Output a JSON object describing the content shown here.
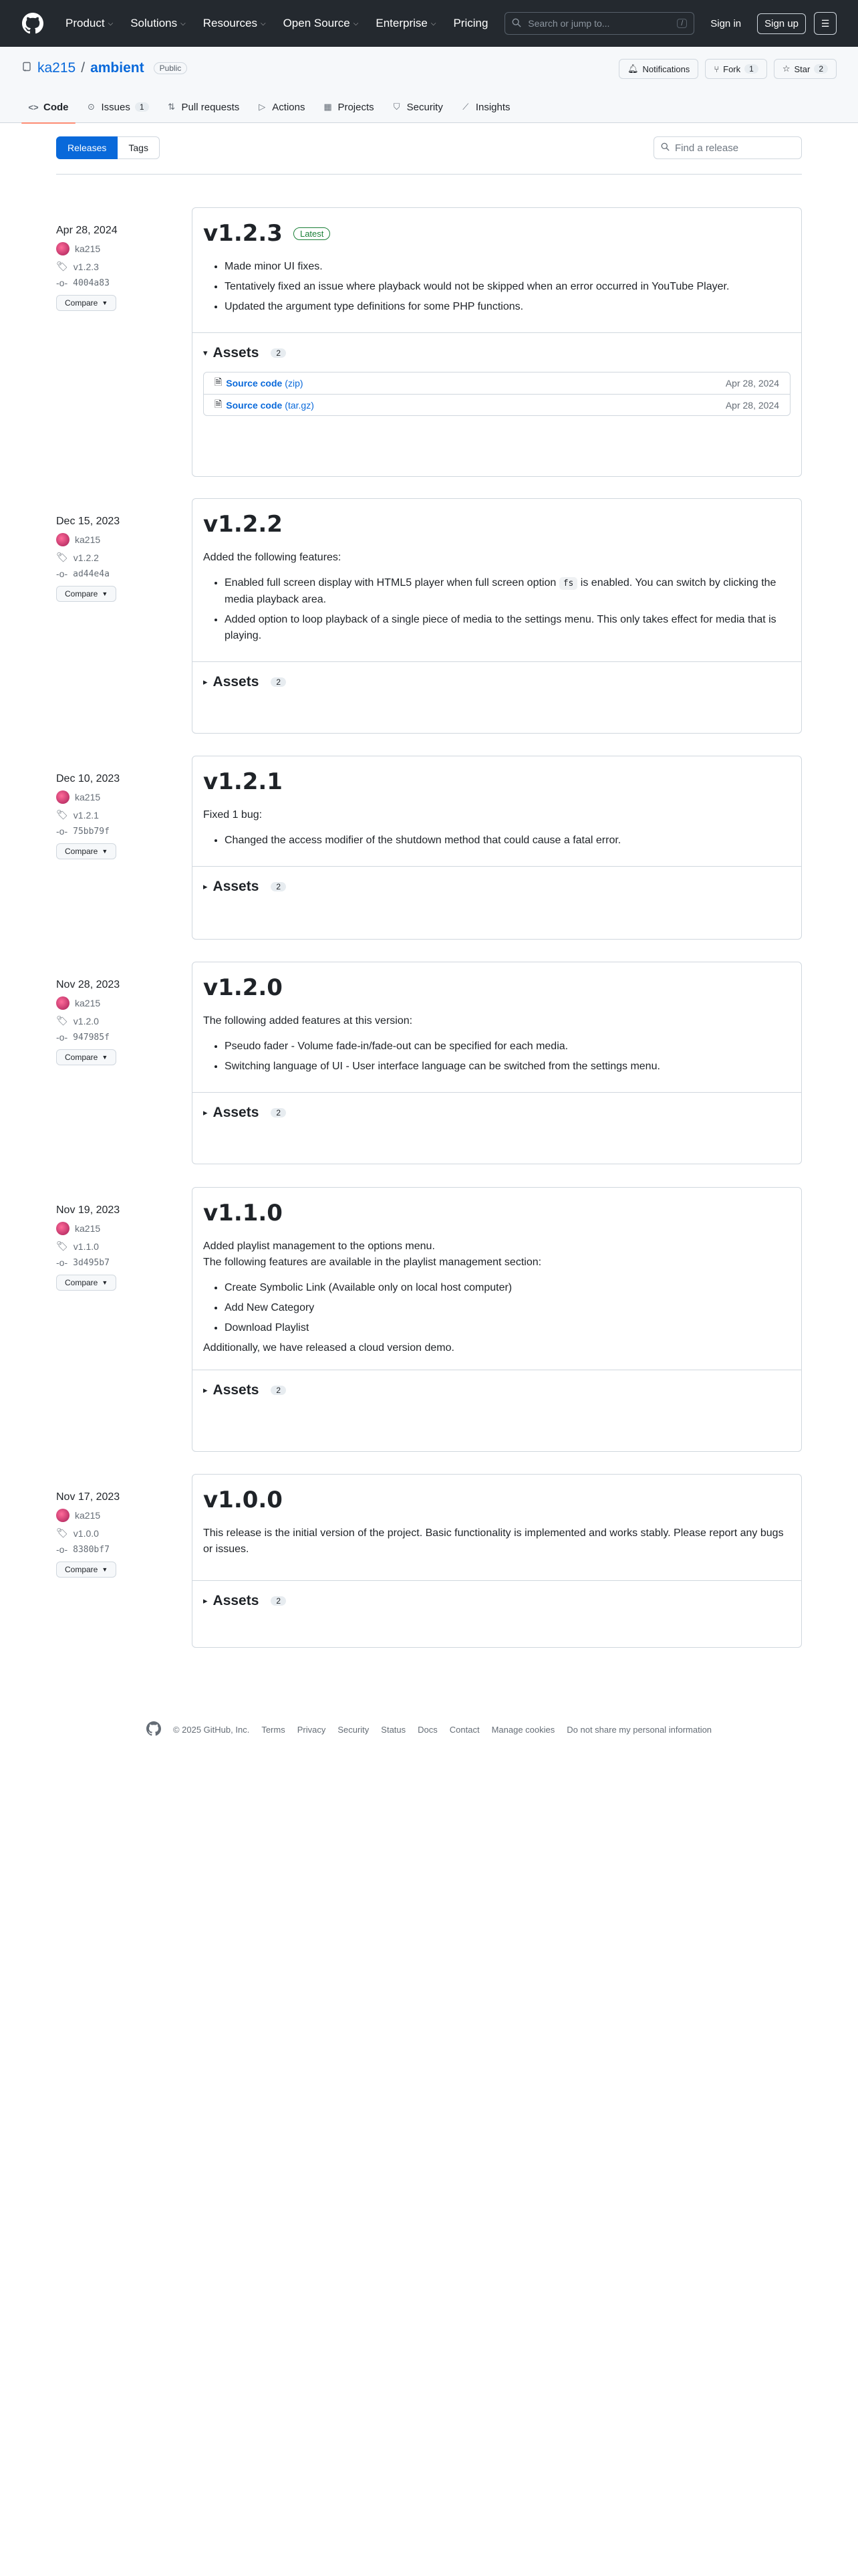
{
  "header": {
    "nav": [
      "Product",
      "Solutions",
      "Resources",
      "Open Source",
      "Enterprise",
      "Pricing"
    ],
    "search_placeholder": "Search or jump to...",
    "search_key": "/",
    "signin": "Sign in",
    "signup": "Sign up"
  },
  "repo": {
    "owner": "ka215",
    "name": "ambient",
    "visibility": "Public",
    "notifications": "Notifications",
    "fork_label": "Fork",
    "fork_count": "1",
    "star_label": "Star",
    "star_count": "2",
    "tabs": [
      {
        "label": "Code",
        "count": ""
      },
      {
        "label": "Issues",
        "count": "1"
      },
      {
        "label": "Pull requests",
        "count": ""
      },
      {
        "label": "Actions",
        "count": ""
      },
      {
        "label": "Projects",
        "count": ""
      },
      {
        "label": "Security",
        "count": ""
      },
      {
        "label": "Insights",
        "count": ""
      }
    ]
  },
  "subnav": {
    "releases": "Releases",
    "tags": "Tags",
    "find_placeholder": "Find a release"
  },
  "releases": [
    {
      "date": "Apr 28, 2024",
      "author": "ka215",
      "tag": "v1.2.3",
      "commit": "4004a83",
      "compare": "Compare",
      "title": "v1.2.3",
      "latest": "Latest",
      "intro": "",
      "notes": [
        "Made minor UI fixes.",
        "Tentatively fixed an issue where playback would not be skipped when an error occurred in YouTube Player.",
        "Updated the argument type definitions for some PHP functions."
      ],
      "after": "",
      "assets_label": "Assets",
      "assets_count": "2",
      "assets": [
        {
          "name": "Source code",
          "ext": "(zip)",
          "date": "Apr 28, 2024"
        },
        {
          "name": "Source code",
          "ext": "(tar.gz)",
          "date": "Apr 28, 2024"
        }
      ]
    },
    {
      "date": "Dec 15, 2023",
      "author": "ka215",
      "tag": "v1.2.2",
      "commit": "ad44e4a",
      "compare": "Compare",
      "title": "v1.2.2",
      "intro": "Added the following features:",
      "notes": [
        "Enabled full screen display with HTML5 player when full screen option |fs| is enabled. You can switch by clicking the media playback area.",
        "Added option to loop playback of a single piece of media to the settings menu. This only takes effect for media that is playing."
      ],
      "after": "",
      "assets_label": "Assets",
      "assets_count": "2"
    },
    {
      "date": "Dec 10, 2023",
      "author": "ka215",
      "tag": "v1.2.1",
      "commit": "75bb79f",
      "compare": "Compare",
      "title": "v1.2.1",
      "intro": "Fixed 1 bug:",
      "notes": [
        "Changed the access modifier of the shutdown method that could cause a fatal error."
      ],
      "after": "",
      "assets_label": "Assets",
      "assets_count": "2"
    },
    {
      "date": "Nov 28, 2023",
      "author": "ka215",
      "tag": "v1.2.0",
      "commit": "947985f",
      "compare": "Compare",
      "title": "v1.2.0",
      "intro": "The following added features at this version:",
      "notes": [
        "Pseudo fader - Volume fade-in/fade-out can be specified for each media.",
        "Switching language of UI - User interface language can be switched from the settings menu."
      ],
      "after": "",
      "assets_label": "Assets",
      "assets_count": "2"
    },
    {
      "date": "Nov 19, 2023",
      "author": "ka215",
      "tag": "v1.1.0",
      "commit": "3d495b7",
      "compare": "Compare",
      "title": "v1.1.0",
      "intro": "Added playlist management to the options menu.\nThe following features are available in the playlist management section:",
      "notes": [
        "Create Symbolic Link (Available only on local host computer)",
        "Add New Category",
        "Download Playlist"
      ],
      "after": "Additionally, we have released a cloud version demo.",
      "assets_label": "Assets",
      "assets_count": "2"
    },
    {
      "date": "Nov 17, 2023",
      "author": "ka215",
      "tag": "v1.0.0",
      "commit": "8380bf7",
      "compare": "Compare",
      "title": "v1.0.0",
      "intro": "This release is the initial version of the project. Basic functionality is implemented and works stably. Please report any bugs or issues.",
      "notes": [],
      "after": "",
      "assets_label": "Assets",
      "assets_count": "2"
    }
  ],
  "footer": {
    "copyright": "© 2025 GitHub, Inc.",
    "links": [
      "Terms",
      "Privacy",
      "Security",
      "Status",
      "Docs",
      "Contact",
      "Manage cookies",
      "Do not share my personal information"
    ]
  },
  "colors": {
    "header_bg": "#24292f",
    "link": "#0969da",
    "accent_tab": "#fd8c73",
    "latest": "#1a7f37"
  }
}
